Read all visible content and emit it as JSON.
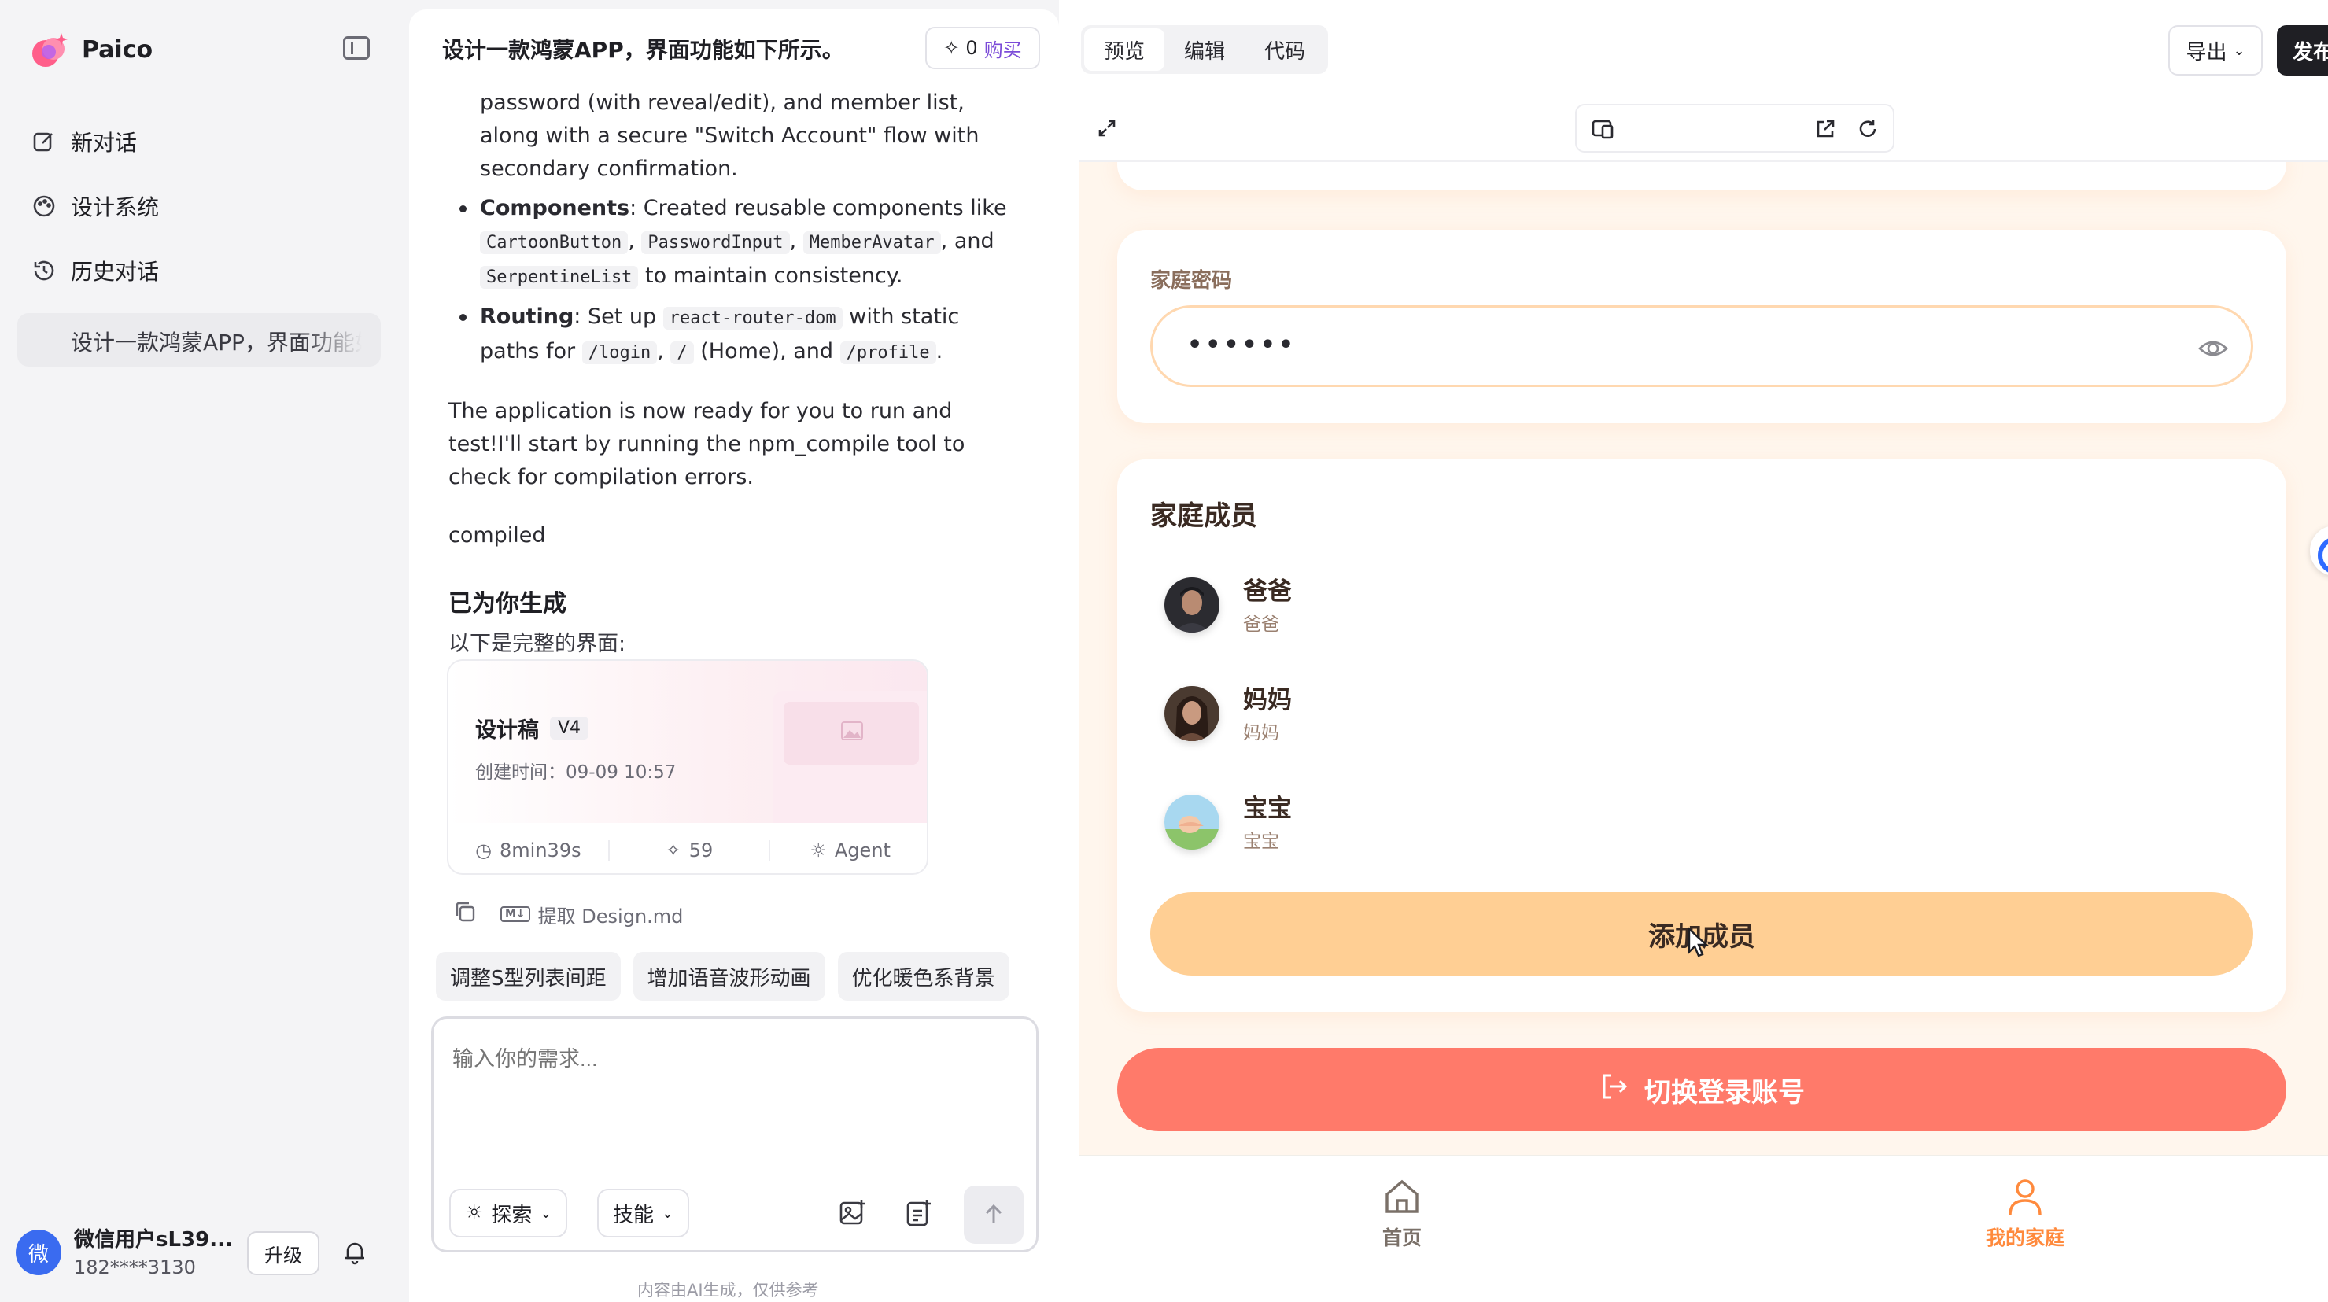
{
  "sidebar": {
    "brand": "Paico",
    "nav": [
      {
        "label": "新对话",
        "icon": "edit-icon"
      },
      {
        "label": "设计系统",
        "icon": "palette-icon"
      },
      {
        "label": "历史对话",
        "icon": "history-icon"
      }
    ],
    "history_item": "设计一款鸿蒙APP，界面功能如下所示。",
    "user": {
      "avatar_text": "微",
      "name": "微信用户sL39...",
      "phone": "182****3130",
      "upgrade": "升级"
    }
  },
  "chat": {
    "title": "设计一款鸿蒙APP，界面功能如下所示。",
    "points": "0",
    "buy": "购买",
    "line_intro": "password (with reveal/edit), and member list, along with a secure \"Switch Account\" flow with secondary confirmation.",
    "components_label": "Components",
    "components_text_a": ": Created reusable components like",
    "components_codes": [
      "CartoonButton",
      "PasswordInput",
      "MemberAvatar",
      "SerpentineList"
    ],
    "components_and": ", and",
    "components_tail": "to maintain consistency.",
    "routing_label": "Routing",
    "routing_text_a": ": Set up",
    "routing_code_lib": "react-router-dom",
    "routing_text_b": "with static paths for",
    "routing_code_login": "/login",
    "routing_code_root": "/",
    "routing_text_c": "(Home), and",
    "routing_code_profile": "/profile",
    "ready_text": "The application is now ready for you to run and test!I'll start by running the npm_compile tool to check for compilation errors.",
    "compiled": "compiled",
    "gen_title": "已为你生成",
    "gen_sub": "以下是完整的界面:",
    "card": {
      "name": "设计稿",
      "version": "V4",
      "time": "创建时间：09-09 10:57",
      "duration": "8min39s",
      "credits": "59",
      "mode": "Agent"
    },
    "extract": "提取 Design.md",
    "chips": [
      "调整S型列表间距",
      "增加语音波形动画",
      "优化暖色系背景"
    ],
    "input_placeholder": "输入你的需求...",
    "explore": "探索",
    "skills": "技能",
    "disclaimer": "内容由AI生成，仅供参考"
  },
  "preview": {
    "tabs": [
      "预览",
      "编辑",
      "代码"
    ],
    "export": "导出",
    "publish": "发布",
    "app": {
      "password_label": "家庭密码",
      "password_mask": "••••••",
      "members_title": "家庭成员",
      "members": [
        {
          "name": "爸爸",
          "role": "爸爸"
        },
        {
          "name": "妈妈",
          "role": "妈妈"
        },
        {
          "name": "宝宝",
          "role": "宝宝"
        }
      ],
      "add_member": "添加成员",
      "switch_account": "切换登录账号",
      "nav": [
        {
          "label": "首页",
          "icon": "home-icon"
        },
        {
          "label": "我的家庭",
          "icon": "user-icon"
        }
      ]
    }
  },
  "colors": {
    "accent": "#ff8a3d",
    "danger_button": "#ff7a6a",
    "add_button": "#ffcf94",
    "stage_bg": "#fff6ed"
  }
}
